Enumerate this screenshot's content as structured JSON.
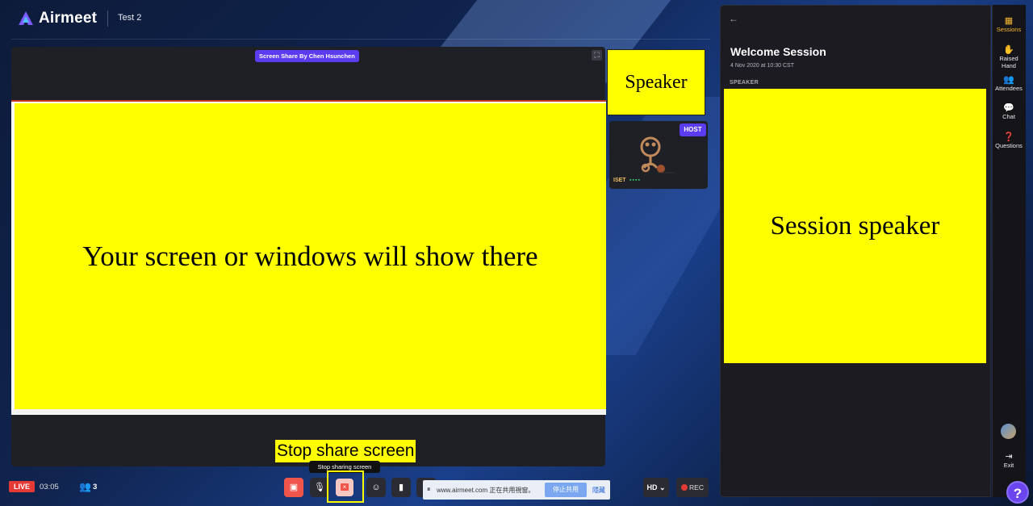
{
  "app": {
    "name": "Airmeet",
    "event_title": "Test 2"
  },
  "stage": {
    "share_badge": "Screen Share By Chen Hsunchen",
    "shared_screen_placeholder": "Your screen or windows will show there"
  },
  "speaker_tiles": {
    "speaker_label": "Speaker",
    "host_badge": "HOST",
    "participant_name": "ISET"
  },
  "session_panel": {
    "title": "Welcome Session",
    "date": "4 Nov 2020 at 10:30 CST",
    "speaker_caption": "SPEAKER",
    "speaker_placeholder": "Session  speaker"
  },
  "rail": {
    "items": [
      {
        "label": "Sessions",
        "icon": "sessions-icon",
        "active": true
      },
      {
        "label": "Raised Hand",
        "icon": "hand-icon",
        "active": false
      },
      {
        "label": "Attendees",
        "icon": "attendees-icon",
        "active": false
      },
      {
        "label": "Chat",
        "icon": "chat-icon",
        "active": false
      },
      {
        "label": "Questions",
        "icon": "question-icon",
        "active": false
      }
    ],
    "exit_label": "Exit"
  },
  "bottom_bar": {
    "live_label": "LIVE",
    "timer": "03:05",
    "attendee_count": "3",
    "stop_share_tooltip": "Stop sharing screen",
    "stop_share_annotation": "Stop share screen",
    "share_notice_text": "www.airmeet.com 正在共用視窗。",
    "share_notice_stop": "停止共用",
    "share_notice_hide": "隱藏",
    "hd_label": "HD",
    "rec_label": "REC"
  },
  "colors": {
    "accent": "#5b3cf0",
    "live": "#e53935",
    "highlight": "#ffff00",
    "active_rail": "#f7b731"
  }
}
